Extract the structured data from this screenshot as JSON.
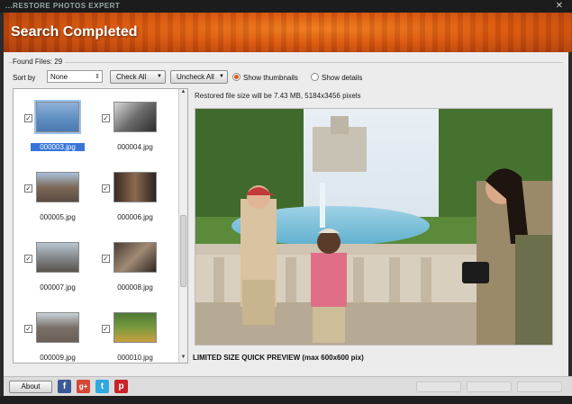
{
  "window": {
    "title": "...RESTORE PHOTOS EXPERT",
    "close_glyph": "✕"
  },
  "banner": {
    "heading": "Search Completed"
  },
  "found_files": "Found Files: 29",
  "toolbar": {
    "sort_label": "Sort by",
    "sort_value": "None",
    "check_all": "Check All",
    "uncheck_all": "Uncheck All",
    "show_thumbnails": "Show thumbnails",
    "show_details": "Show details",
    "selected_view": "thumbnails"
  },
  "files": [
    {
      "name": "000003.jpg",
      "checked": true,
      "selected": true
    },
    {
      "name": "000004.jpg",
      "checked": true,
      "selected": false
    },
    {
      "name": "000005.jpg",
      "checked": true,
      "selected": false
    },
    {
      "name": "000006.jpg",
      "checked": true,
      "selected": false
    },
    {
      "name": "000007.jpg",
      "checked": true,
      "selected": false
    },
    {
      "name": "000008.jpg",
      "checked": true,
      "selected": false
    },
    {
      "name": "000009.jpg",
      "checked": true,
      "selected": false
    },
    {
      "name": "000010.jpg",
      "checked": true,
      "selected": false
    }
  ],
  "preview": {
    "info": "Restored file size will be 7.43 MB, 5184x3456 pixels",
    "caption": "LIMITED SIZE QUICK PREVIEW (max 600x600 pix)"
  },
  "footer": {
    "about": "About",
    "social": [
      {
        "icon": "facebook-icon",
        "glyph": "f",
        "color": "#3b5998"
      },
      {
        "icon": "google-plus-icon",
        "glyph": "g+",
        "color": "#d34836"
      },
      {
        "icon": "twitter-icon",
        "glyph": "t",
        "color": "#2fa8e0"
      },
      {
        "icon": "pinterest-icon",
        "glyph": "p",
        "color": "#c8232c"
      }
    ]
  },
  "colors": {
    "accent": "#e05a14",
    "selection": "#3875d7"
  }
}
